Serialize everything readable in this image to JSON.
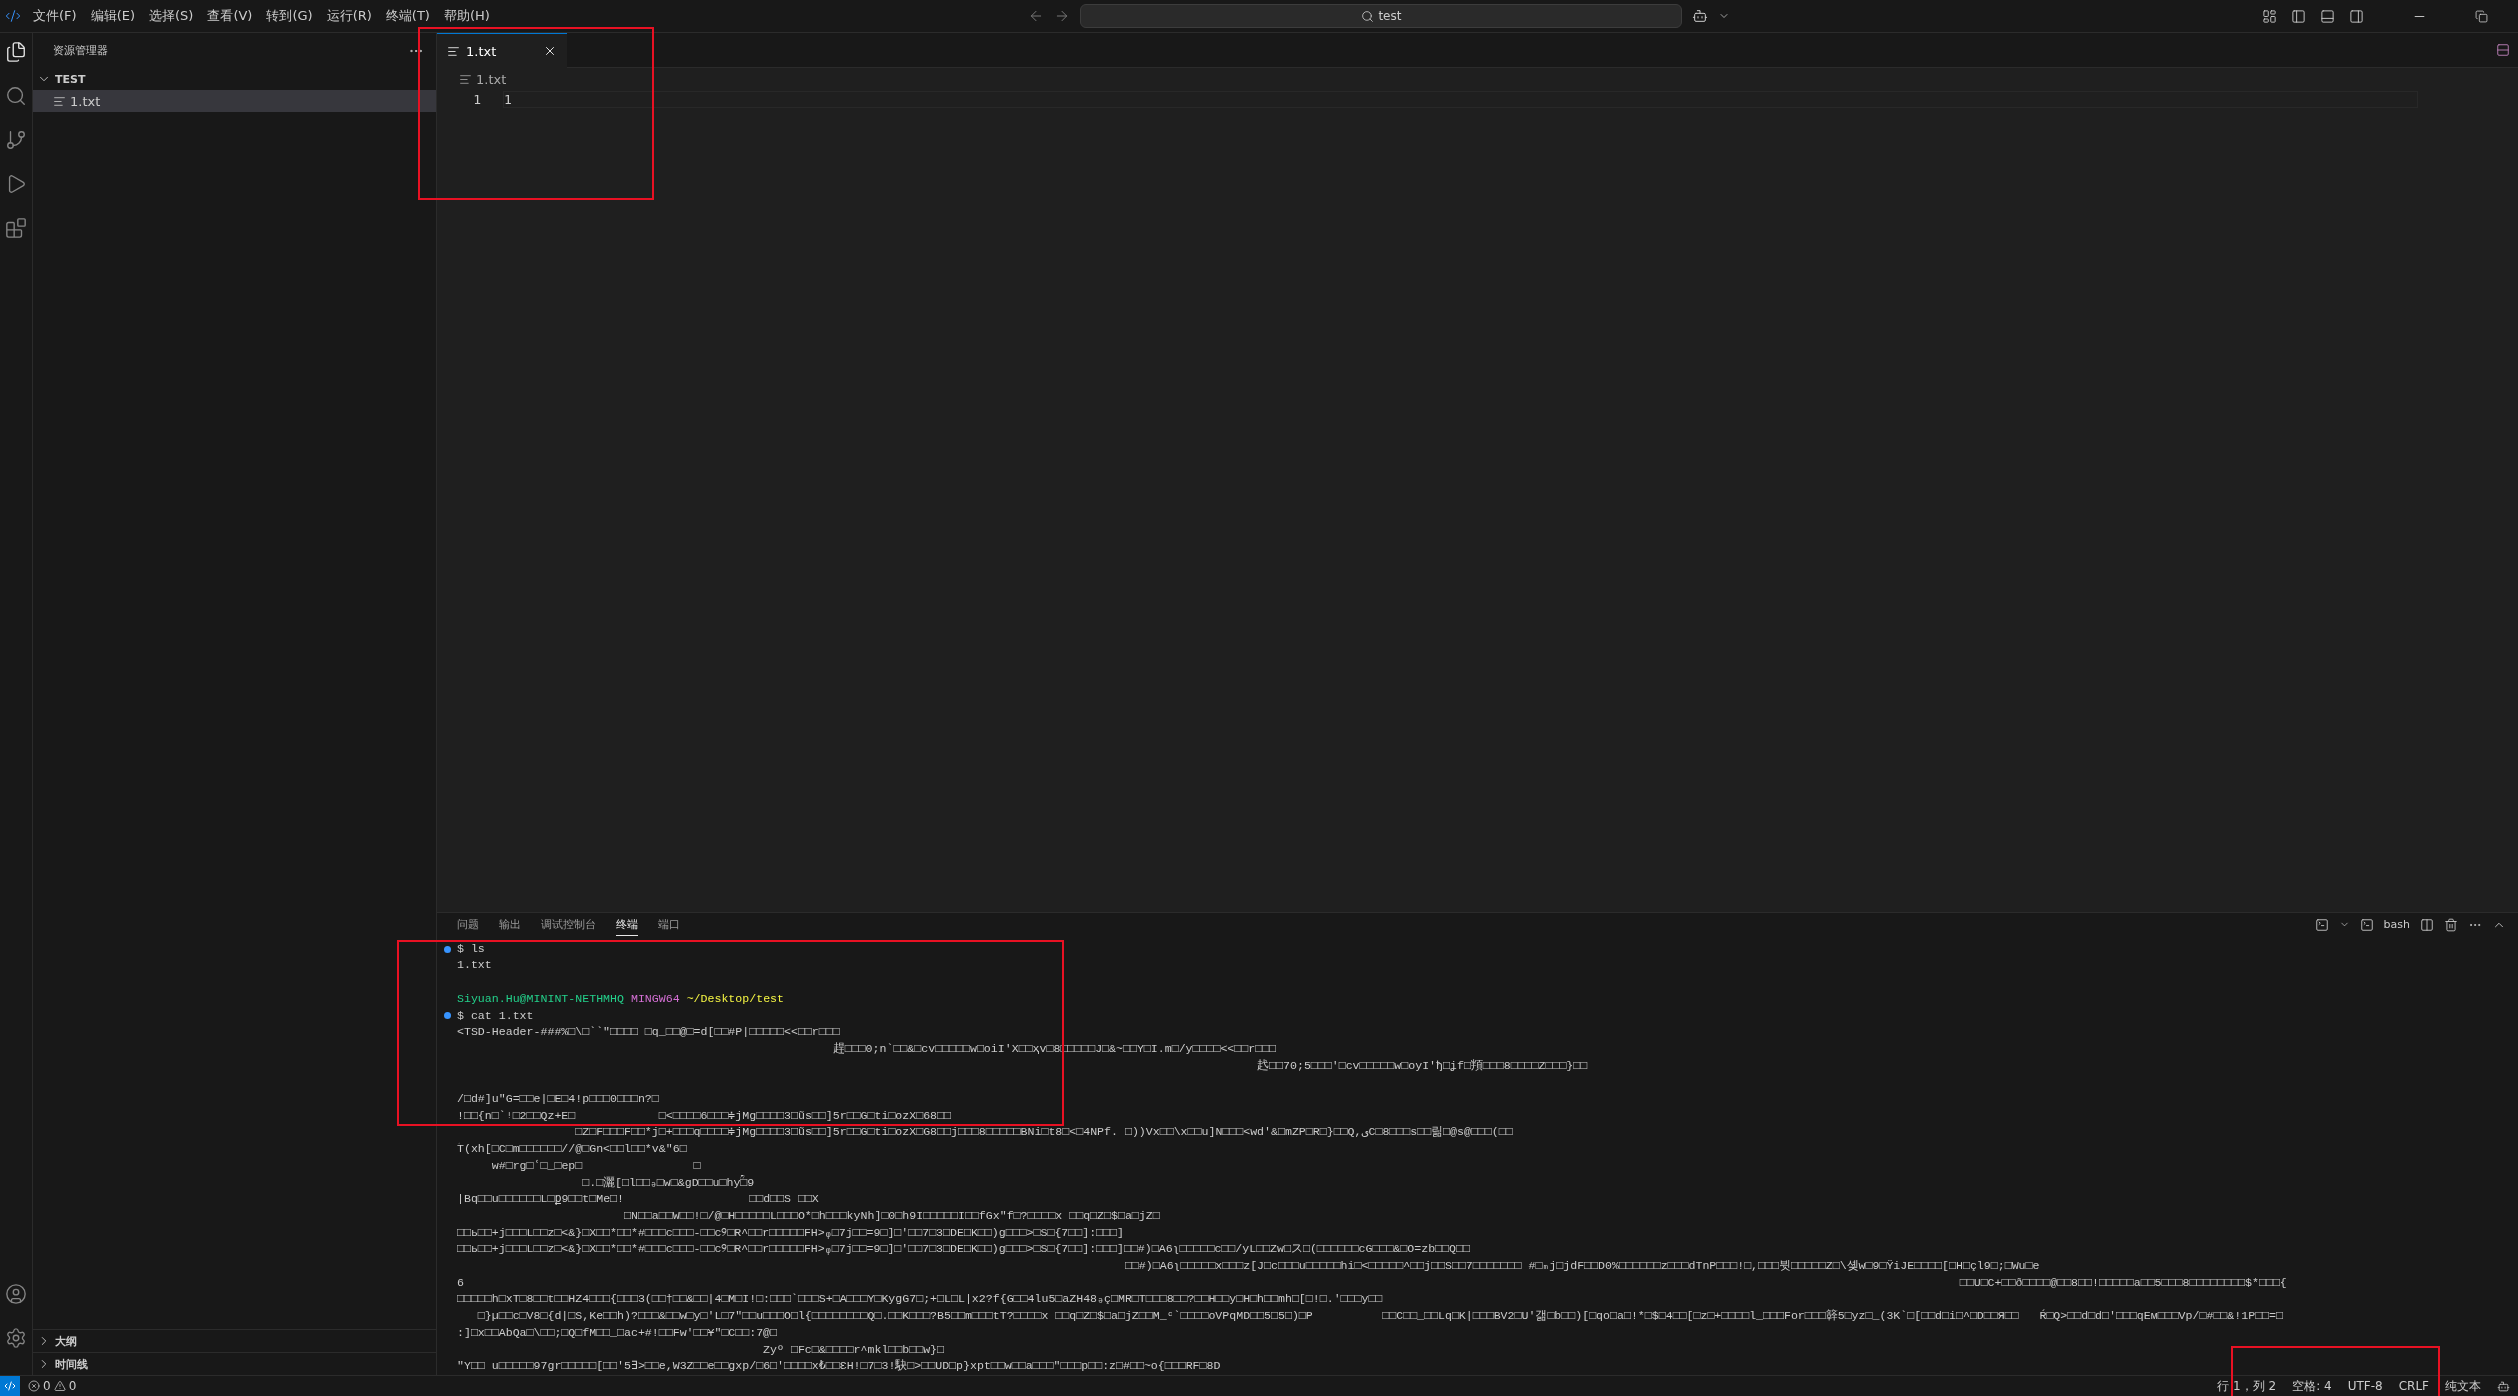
{
  "title_bar": {
    "menus": [
      "文件(F)",
      "编辑(E)",
      "选择(S)",
      "查看(V)",
      "转到(G)",
      "运行(R)",
      "终端(T)",
      "帮助(H)"
    ],
    "search": {
      "value": "test"
    }
  },
  "activity_bar": {
    "items": [
      {
        "kind": "explorer",
        "selected": true
      },
      {
        "kind": "search",
        "selected": false
      },
      {
        "kind": "source-control",
        "selected": false
      },
      {
        "kind": "run",
        "selected": false
      },
      {
        "kind": "extensions",
        "selected": false
      }
    ],
    "bottom": [
      {
        "kind": "account"
      },
      {
        "kind": "settings"
      }
    ]
  },
  "sidebar": {
    "title": "资源管理器",
    "folder": {
      "name": "TEST",
      "expanded": true,
      "files": [
        {
          "name": "1.txt",
          "selected": true
        }
      ]
    },
    "sections": [
      {
        "name": "大纲",
        "expanded": false
      },
      {
        "name": "时间线",
        "expanded": false
      }
    ]
  },
  "editor": {
    "tabs": [
      {
        "label": "1.txt",
        "selected": true
      }
    ],
    "breadcrumb": "1.txt",
    "lines": [
      {
        "number": "1",
        "text": "1"
      }
    ]
  },
  "panel": {
    "tabs": [
      {
        "label": "问题",
        "selected": false
      },
      {
        "label": "输出",
        "selected": false
      },
      {
        "label": "调试控制台",
        "selected": false
      },
      {
        "label": "终端",
        "selected": true
      },
      {
        "label": "端口",
        "selected": false
      }
    ],
    "terminal_name": "bash",
    "lines": [
      {
        "kind": "command",
        "text": "$ ls"
      },
      {
        "kind": "output",
        "text": "1.txt"
      },
      {
        "kind": "blank"
      },
      {
        "kind": "prompt",
        "user": "Siyuan.Hu@MININT-NETHMHQ",
        "shell": "MINGW64",
        "path": "~/Desktop/test"
      },
      {
        "kind": "command",
        "text": "$ cat 1.txt"
      },
      {
        "kind": "output",
        "text": "<TSD-Header-###%□\\□``\"□□□□ □q_□□@□=d[□□#P|□□□□□<<□□r□□□"
      },
      {
        "kind": "output",
        "text": "                                                      趕□□□0;n`□□&□cv□□□□□w□oiI'X□□ҳv□8□□□□□J□&~□□Y□I.m□/y□□□□<<□□r□□□"
      },
      {
        "kind": "output",
        "text": "                                                                                                                   䞖□□70;5□□□'□cv□□□□□w□oyI'ђ□ʝf□頖□□□8□□□□Z□□□}□□"
      },
      {
        "kind": "blank"
      },
      {
        "kind": "output",
        "text": "/□d#]u\"G=□□e|□E□4!p□□□0□□□n?□"
      },
      {
        "kind": "output",
        "text": "!□□{n□`ᵎ□2□□Qz+E□            □<□□□□6□□□≑jMg□□□□3□ũs□□]5r□□G□ti□ozX□68□□"
      },
      {
        "kind": "output",
        "text": "                 □Z□F□□□F□□*j□+□□□q□□□□≑jMg□□□□3□ũs□□]5r□□G□ti□ozX□G8□□j□□□8□□□□□BNi□t8□<□4NPf. □))Vx□□\\x□□u]N□□□<wd'&□mZP□R□}□□Q,ىC□8□□□s□□릶□@s@□□□(□□"
      },
      {
        "kind": "output",
        "text": "ؘT(xh[□C□m□□□□□□//@□Gn<□□l□□*v&\"6□"
      },
      {
        "kind": "output",
        "text": "     w#□rg□ՙ□_□ep□                □"
      },
      {
        "kind": "output",
        "text": "                  □.□灑[□l□□ₔ□w□&gD□□u□hyؒ□9"
      },
      {
        "kind": "output",
        "text": "|Bq□□u□□□□□□L□ք9□□t□Me□!                  □□d□□S □□X"
      },
      {
        "kind": "output",
        "text": "                        □N□□a□□W□□!□/@□H□□□□□L□□□O*□h□□□kyNh]□0□h9I□□□□□I□□fGx\"f□?□□□□x □□q□Z□$□a□jZ□"
      },
      {
        "kind": "output",
        "text": "□□ь□□+j□□□L□□z□<&}□X□□*□□*#□□□c□□□-□□c୨□R^□□r□□□□□FH>ᵩ□7j□□=9□]□'□□7□3□DE□K□□)g□□□>□S□{7□□]:□□□]"
      },
      {
        "kind": "output",
        "text": "□□ь□□+j□□□L□□z□<&}□X□□*□□*#□□□c□□□-□□c୨□R^□□r□□□□□FH>ᵩ□7j□□=9□]□'□□7□3□DE□K□□)g□□□>□S□{7□□]:□□□]□□#)□A6ʅ□□□□□c□□/yL□□Zw□ス□(□□□□□□cG□□□&□O=zb□□Q□□"
      },
      {
        "kind": "output",
        "text": "                                                                                                □□#)□A6ʅ□□□□□x□□□z[J□c□□□u□□□□□hi□<□□□□□^□□j□□S□□7□□□□□□□ #□ₘj□jdF□□D0%□□□□□□z□□□dTnP□□□!□,□□□뷧□□□□□Z□\\솆w□9□ŸiJE□□□□[□H□çl9□;□Wu□e"
      },
      {
        "kind": "output",
        "text": "6                                                                                                                                                                                                                       □□U□C+□□ð□□□□@□□8□□!□□□□□a□□5□□□8□□□□□□□□$*□□□{"
      },
      {
        "kind": "output",
        "text": "□□□□□h□xT□8□□t□□HZ4□□□{□□□3(□□†□□&□□|4□M□I!□:□□□`□□□S+□A□□□Y□KygG7□;+□L□L|x2?f{G□□4lu5□aZH48ₔç□MR□T□□□8□□?□□H□□y□H□h□□mh□[□!□.'□□□y□□"
      },
      {
        "kind": "output",
        "text": "   □}µ□□c□V8□{d|□S,Ke□□h)?□□□&□□w□y□'L□7\"□□u□□□O□l{□□□□□□□□Q□.□□K□□□?B5□□m□□□tT?□□□□x □□q□Z□$□a□jZ□□M_ᶜ`□□□□oVPqMD□□5□5□)□P          □□C□□_□□Lq□K|□□□BV2□U'갦□b□□)[□qo□a□!*□$□4□□[□z□+□□□□l_□□□For□□□簳5□yz□_(3K`□[□□d□i□^□D□□Я□□   Ŕ□Q>□□d□d□'□□□qEм□□□Vp/□#□□&!1P□□=□"
      },
      {
        "kind": "output",
        "text": ":]□x□□AbQa□\\□□;□Q□fM□□_□ac+#!□□Fw'□□Ұ\"□C□□:7@□"
      },
      {
        "kind": "output",
        "text": "                                            Zyº □Fc□&□□□□r^mkl□□b□□w}□"
      },
      {
        "kind": "output",
        "text": "″Y□□ u□□□□□97gr□□□□□[□□'5∃>□□e,W3Z□□e□□gxp/□6□'□□□□x₺□□ƐH!□7□3!駃□>□□UD□p}xpt□□w□□a□□□\"□□□p□□:z□#□□~o{□□□RF□8D"
      }
    ]
  },
  "status_bar": {
    "errors": "0",
    "warnings": "0",
    "items": [
      "行 1，列 2",
      "空格: 4",
      "UTF-8",
      "CRLF",
      "纯文本"
    ]
  }
}
